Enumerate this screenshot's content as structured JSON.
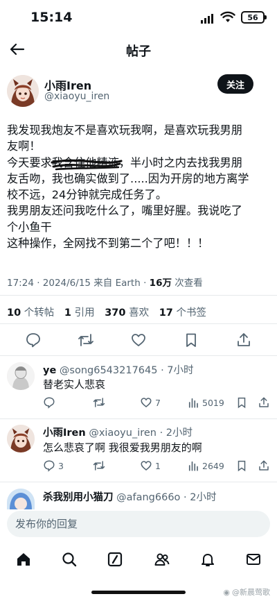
{
  "status_bar": {
    "time": "15:14",
    "battery": "56"
  },
  "header": {
    "title": "帖子"
  },
  "post": {
    "author_name": "小雨Iren",
    "author_handle": "@xiaoyu_iren",
    "follow_label": "关注",
    "lines": [
      "我发现我炮友不是喜欢玩我啊，是喜欢玩我男朋",
      "友啊！"
    ],
    "line3_pre": "今天要求",
    "line3_struck": "我含住他精液",
    "line3_post": "，半小时之内去找我男朋",
    "lines_rest": [
      "友舌吻，我也确实做到了.....因为开房的地方离学",
      "校不远，24分钟就完成任务了。",
      "我男朋友还问我吃什么了，嘴里好腥。我说吃了",
      "个小鱼干",
      "这种操作，全网找不到第二个了吧！！！"
    ],
    "meta_time": "17:24 · 2024/6/15 来自 Earth · ",
    "meta_views": "16万",
    "meta_views_label": " 次查看"
  },
  "stats": {
    "retweets": "10",
    "retweets_label": " 个转帖",
    "quotes": "1",
    "quotes_label": " 引用",
    "likes": "370",
    "likes_label": " 喜欢",
    "bookmarks": "17",
    "bookmarks_label": " 个书签"
  },
  "replies": [
    {
      "name": "ye",
      "handle": "@song6543217645 · 7小时",
      "text": "替老实人悲哀",
      "comments": "",
      "likes": "7",
      "views": "5019"
    },
    {
      "name": "小雨Iren",
      "handle": "@xiaoyu_iren · 2小时",
      "text": "怎么悲哀了啊 我很爱我男朋友的啊",
      "comments": "3",
      "likes": "1",
      "views": "2649"
    },
    {
      "name": "杀我别用小猫刀",
      "handle": "@afang666o · 2小时"
    }
  ],
  "compose": {
    "placeholder": "发布你的回复"
  },
  "watermark": "@新晨莺歌",
  "icons": {
    "tabs": [
      "home-icon",
      "search-icon",
      "grok-icon",
      "people-icon",
      "bell-icon",
      "mail-icon"
    ],
    "actions": [
      "reply-icon",
      "retweet-icon",
      "like-icon",
      "bookmark-icon",
      "share-icon"
    ]
  },
  "colors": {
    "text": "#0f1419",
    "secondary": "#536471",
    "divider": "#e6e9eb",
    "follow_bg": "#0f1419"
  }
}
